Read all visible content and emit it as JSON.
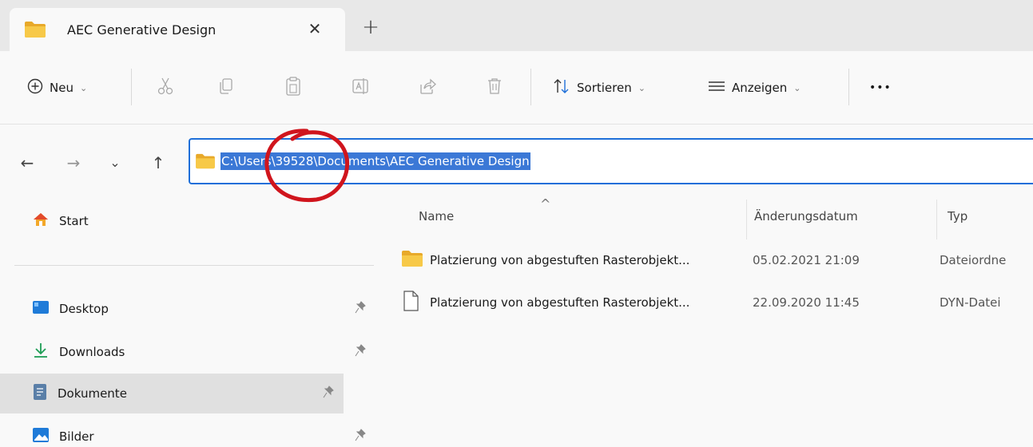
{
  "tab": {
    "title": "AEC Generative Design",
    "close": "✕",
    "new_tab": "+"
  },
  "commandbar": {
    "new_label": "Neu",
    "sort_label": "Sortieren",
    "view_label": "Anzeigen",
    "more": "•••",
    "chevron": "⌄"
  },
  "navigation": {
    "back": "←",
    "forward": "→",
    "recent": "⌄",
    "up": "↑"
  },
  "address": {
    "path": "C:\\Users\\39528\\Documents\\AEC Generative Design",
    "annotation_color": "#d0151d"
  },
  "sidebar": {
    "items": [
      {
        "label": "Start",
        "icon": "home-icon"
      },
      {
        "label": "Desktop",
        "icon": "desktop-icon",
        "pinned": true
      },
      {
        "label": "Downloads",
        "icon": "download-icon",
        "pinned": true
      },
      {
        "label": "Dokumente",
        "icon": "documents-icon",
        "pinned": true,
        "selected": true
      },
      {
        "label": "Bilder",
        "icon": "pictures-icon",
        "pinned": true
      }
    ],
    "pin_glyph": "📌"
  },
  "filelist": {
    "columns": {
      "name": "Name",
      "date": "Änderungsdatum",
      "type": "Typ"
    },
    "sort_indicator": "^",
    "rows": [
      {
        "name": "Platzierung von abgestuften Rasterobjekt...",
        "date": "05.02.2021 21:09",
        "type": "Dateiordne",
        "icon": "folder-icon"
      },
      {
        "name": "Platzierung von abgestuften Rasterobjekt...",
        "date": "22.09.2020 11:45",
        "type": "DYN-Datei",
        "icon": "file-icon"
      }
    ]
  },
  "colors": {
    "accent": "#1e6fd9",
    "selection": "#3b78d6",
    "folder": "#f5c242"
  }
}
